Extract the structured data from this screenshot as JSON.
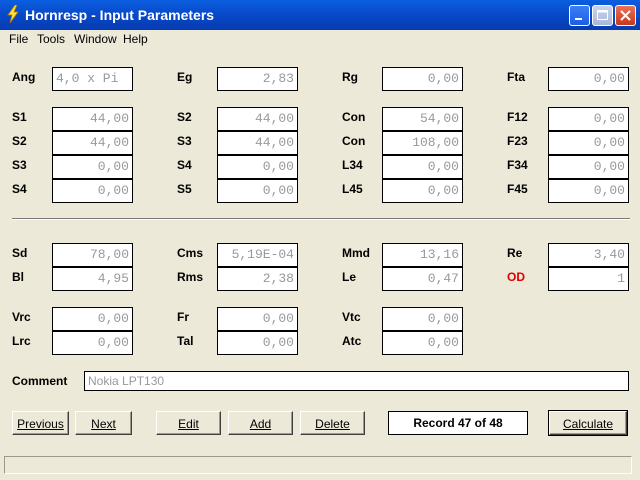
{
  "window": {
    "title": "Hornresp - Input Parameters",
    "icon": "lightning-bolt-icon"
  },
  "menu": [
    "File",
    "Tools",
    "Window",
    "Help"
  ],
  "params": {
    "ang": {
      "label": "Ang",
      "value": "4,0 x Pi"
    },
    "eg": {
      "label": "Eg",
      "value": "2,83"
    },
    "rg": {
      "label": "Rg",
      "value": "0,00"
    },
    "fta": {
      "label": "Fta",
      "value": "0,00"
    },
    "s1": {
      "label": "S1",
      "value": "44,00"
    },
    "s2a": {
      "label": "S2",
      "value": "44,00"
    },
    "s3a": {
      "label": "S3",
      "value": "0,00"
    },
    "s4a": {
      "label": "S4",
      "value": "0,00"
    },
    "s2b": {
      "label": "S2",
      "value": "44,00"
    },
    "s3b": {
      "label": "S3",
      "value": "44,00"
    },
    "s4b": {
      "label": "S4",
      "value": "0,00"
    },
    "s5": {
      "label": "S5",
      "value": "0,00"
    },
    "con1": {
      "label": "Con",
      "value": "54,00"
    },
    "con2": {
      "label": "Con",
      "value": "108,00"
    },
    "l34": {
      "label": "L34",
      "value": "0,00"
    },
    "l45": {
      "label": "L45",
      "value": "0,00"
    },
    "f12": {
      "label": "F12",
      "value": "0,00"
    },
    "f23": {
      "label": "F23",
      "value": "0,00"
    },
    "f34": {
      "label": "F34",
      "value": "0,00"
    },
    "f45": {
      "label": "F45",
      "value": "0,00"
    },
    "sd": {
      "label": "Sd",
      "value": "78,00"
    },
    "bl": {
      "label": "Bl",
      "value": "4,95"
    },
    "cms": {
      "label": "Cms",
      "value": "5,19E-04"
    },
    "rms": {
      "label": "Rms",
      "value": "2,38"
    },
    "mmd": {
      "label": "Mmd",
      "value": "13,16"
    },
    "le": {
      "label": "Le",
      "value": "0,47"
    },
    "re": {
      "label": "Re",
      "value": "3,40"
    },
    "od": {
      "label": "OD",
      "value": "1"
    },
    "vrc": {
      "label": "Vrc",
      "value": "0,00"
    },
    "lrc": {
      "label": "Lrc",
      "value": "0,00"
    },
    "fr": {
      "label": "Fr",
      "value": "0,00"
    },
    "tal": {
      "label": "Tal",
      "value": "0,00"
    },
    "vtc": {
      "label": "Vtc",
      "value": "0,00"
    },
    "atc": {
      "label": "Atc",
      "value": "0,00"
    }
  },
  "comment": {
    "label": "Comment",
    "value": "Nokia LPT130"
  },
  "buttons": {
    "previous": "Previous",
    "next": "Next",
    "edit": "Edit",
    "add": "Add",
    "delete": "Delete",
    "calculate": "Calculate"
  },
  "record": "Record 47 of 48",
  "colors": {
    "titlebar": "#0848c8",
    "window_bg": "#ece9d8",
    "field_text": "#999999",
    "od_label": "#e00000"
  }
}
